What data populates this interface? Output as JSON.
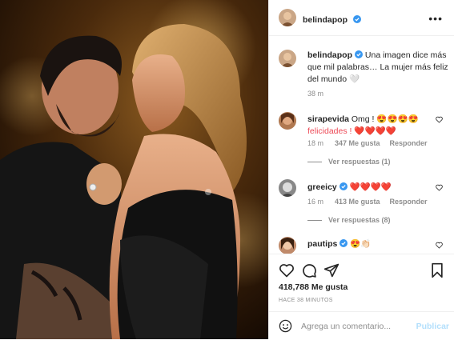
{
  "post": {
    "author": "belindapop",
    "caption": "Una imagen dice más que mil palabras… La mujer más feliz del mundo 🤍",
    "caption_time": "38 m",
    "likes_count": "418,788 Me gusta",
    "time_ago": "HACE 38 MINUTOS"
  },
  "comments": [
    {
      "user": "sirapevida",
      "line1": "Omg ! 😍😍😍😍",
      "line2": "felicidades ! ❤️❤️❤️❤️",
      "time": "18 m",
      "likes": "347 Me gusta",
      "reply": "Responder",
      "view_replies": "Ver respuestas (1)"
    },
    {
      "user": "greeicy",
      "line1": "❤️❤️❤️❤️",
      "time": "16 m",
      "likes": "413 Me gusta",
      "reply": "Responder",
      "view_replies": "Ver respuestas (8)"
    },
    {
      "user": "pautips",
      "line1": "😍👏🏻"
    }
  ],
  "add_comment": {
    "placeholder": "Agrega un comentario...",
    "publish": "Publicar"
  },
  "icons": [
    "heart-icon",
    "comment-icon",
    "share-icon",
    "bookmark-icon",
    "emoji-icon",
    "more-icon",
    "verified-icon"
  ],
  "colors": {
    "verified": "#3897f0",
    "muted": "#8e8e8e",
    "publish_disabled": "#b2dffc",
    "heart": "#ed4956"
  }
}
